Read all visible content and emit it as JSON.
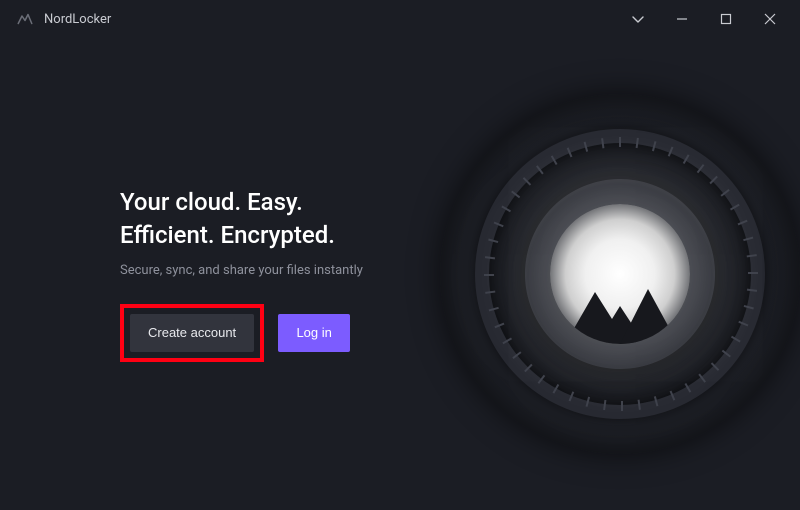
{
  "titlebar": {
    "app_name": "NordLocker"
  },
  "main": {
    "headline_line1": "Your cloud. Easy.",
    "headline_line2": "Efficient. Encrypted.",
    "subhead": "Secure, sync, and share your files instantly",
    "create_account_label": "Create account",
    "login_label": "Log in"
  },
  "colors": {
    "accent": "#7c5cff",
    "highlight_box": "#ff0013",
    "background": "#1b1d24"
  }
}
